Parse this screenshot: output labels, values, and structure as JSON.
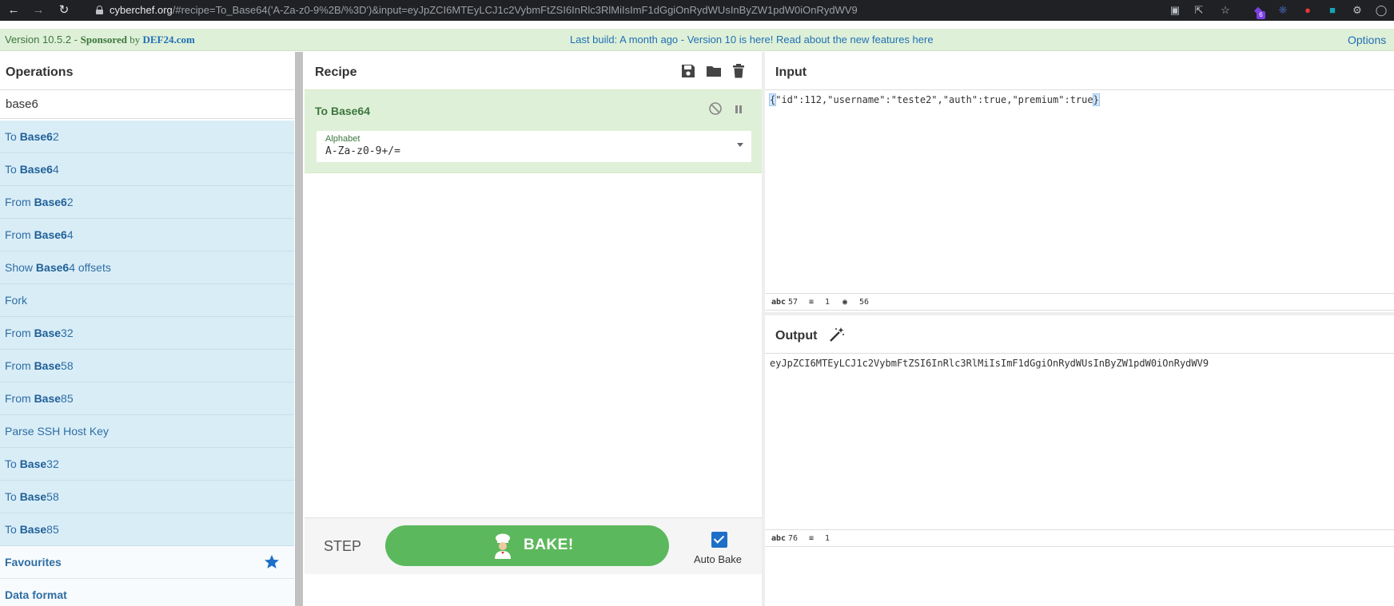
{
  "browser": {
    "url_host": "cyberchef.org",
    "url_rest": "/#recipe=To_Base64('A-Za-z0-9%2B/%3D')&input=eyJpZCI6MTEyLCJ1c2VybmFtZSI6InRlc3RlMiIsImF1dGgiOnRydWUsInByZW1pdW0iOnRydWV9",
    "extension_badge": "6"
  },
  "banner": {
    "version": "Version 10.5.2 - ",
    "sponsored": "Sponsored",
    "by": " by ",
    "sponsor": "DEF24.com",
    "notice": "Last build: A month ago - Version 10 is here! Read about the new features here",
    "options": "Options"
  },
  "operations": {
    "title": "Operations",
    "search_value": "base6",
    "items": [
      {
        "pre": "To ",
        "match": "Base6",
        "post": "2"
      },
      {
        "pre": "To ",
        "match": "Base6",
        "post": "4"
      },
      {
        "pre": "From ",
        "match": "Base6",
        "post": "2"
      },
      {
        "pre": "From ",
        "match": "Base6",
        "post": "4"
      },
      {
        "pre": "Show ",
        "match": "Base6",
        "post": "4 offsets"
      },
      {
        "pre": "Fork",
        "match": "",
        "post": ""
      },
      {
        "pre": "From ",
        "match": "Base",
        "post": "32"
      },
      {
        "pre": "From ",
        "match": "Base",
        "post": "58"
      },
      {
        "pre": "From ",
        "match": "Base",
        "post": "85"
      },
      {
        "pre": "Parse SSH Host Key",
        "match": "",
        "post": ""
      },
      {
        "pre": "To ",
        "match": "Base",
        "post": "32"
      },
      {
        "pre": "To ",
        "match": "Base",
        "post": "58"
      },
      {
        "pre": "To ",
        "match": "Base",
        "post": "85"
      }
    ],
    "categories": [
      "Favourites",
      "Data format"
    ]
  },
  "recipe": {
    "title": "Recipe",
    "op_name": "To Base64",
    "alphabet_label": "Alphabet",
    "alphabet_value": "A-Za-z0-9+/=",
    "step_label": "STEP",
    "bake_label": "BAKE!",
    "autobake_label": "Auto Bake",
    "autobake_checked": true
  },
  "input": {
    "title": "Input",
    "text_open": "{",
    "text_body": "\"id\":112,\"username\":\"teste2\",\"auth\":true,\"premium\":true",
    "text_close": "}",
    "status": {
      "chars": "57",
      "lines": "1",
      "pos": "56"
    }
  },
  "output": {
    "title": "Output",
    "text": "eyJpZCI6MTEyLCJ1c2VybmFtZSI6InRlc3RlMiIsImF1dGgiOnRydWUsInByZW1pdW0iOnRydWV9",
    "status": {
      "chars": "76",
      "lines": "1"
    }
  },
  "colors": {
    "banner_bg": "#dff0d8",
    "op_item_bg": "#d9edf7",
    "bake_button": "#5cb85c",
    "link_blue": "#1f6fb5"
  }
}
